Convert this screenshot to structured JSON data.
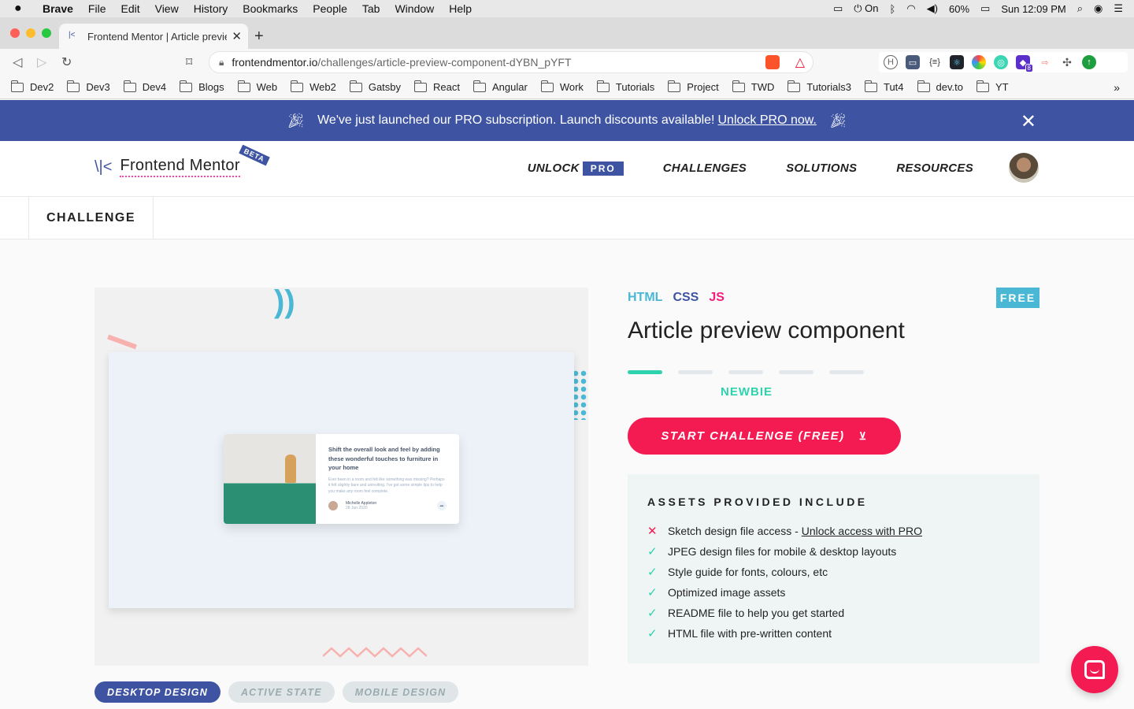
{
  "menubar": {
    "apple": "",
    "items": [
      "Brave",
      "File",
      "Edit",
      "View",
      "History",
      "Bookmarks",
      "People",
      "Tab",
      "Window",
      "Help"
    ],
    "bluetooth_label": "On",
    "battery": "60%",
    "clock": "Sun 12:09 PM"
  },
  "browser": {
    "tab_title": "Frontend Mentor | Article preview",
    "url_host": "frontendmentor.io",
    "url_path": "/challenges/article-preview-component-dYBN_pYFT",
    "extension_badge": "8",
    "bookmarks": [
      "Dev2",
      "Dev3",
      "Dev4",
      "Blogs",
      "Web",
      "Web2",
      "Gatsby",
      "React",
      "Angular",
      "Work",
      "Tutorials",
      "Project",
      "TWD",
      "Tutorials3",
      "Tut4",
      "dev.to",
      "YT"
    ],
    "bookmarks_more": "»"
  },
  "promo": {
    "text": "We've just launched our PRO subscription. Launch discounts available!",
    "link": "Unlock PRO now."
  },
  "header": {
    "logo_text": "Frontend Mentor",
    "beta": "BETA",
    "nav": {
      "unlock": "UNLOCK",
      "pro": "PRO",
      "challenges": "CHALLENGES",
      "solutions": "SOLUTIONS",
      "resources": "RESOURCES"
    }
  },
  "subnav": {
    "label": "CHALLENGE"
  },
  "preview_card": {
    "title": "Shift the overall look and feel by adding these wonderful touches to furniture in your home",
    "body": "Ever been in a room and felt like something was missing? Perhaps it felt slightly bare and uninviting. I've got some simple tips to help you make any room feel complete.",
    "author": "Michelle Appleton",
    "date": "28 Jun 2020"
  },
  "challenge": {
    "tags": {
      "html": "HTML",
      "css": "CSS",
      "js": "JS"
    },
    "price_badge": "FREE",
    "title": "Article preview component",
    "difficulty_level": 1,
    "difficulty_max": 5,
    "difficulty_label": "NEWBIE",
    "start_button": "START CHALLENGE (FREE)",
    "start_icon": "⊻"
  },
  "assets": {
    "heading": "ASSETS PROVIDED INCLUDE",
    "items": [
      {
        "text": "Sketch design file access -",
        "link": "Unlock access with PRO",
        "included": false
      },
      {
        "text": "JPEG design files for mobile & desktop layouts",
        "included": true
      },
      {
        "text": "Style guide for fonts, colours, etc",
        "included": true
      },
      {
        "text": "Optimized image assets",
        "included": true
      },
      {
        "text": "README file to help you get started",
        "included": true
      },
      {
        "text": "HTML file with pre-written content",
        "included": true
      }
    ]
  },
  "preview_tabs": [
    "DESKTOP DESIGN",
    "ACTIVE STATE",
    "MOBILE DESIGN"
  ],
  "colors": {
    "brand_blue": "#3e54a3",
    "accent_red": "#f41b53",
    "accent_teal": "#2ed3ae",
    "accent_cyan": "#4ab8d4",
    "accent_pink": "#f41b7e"
  }
}
